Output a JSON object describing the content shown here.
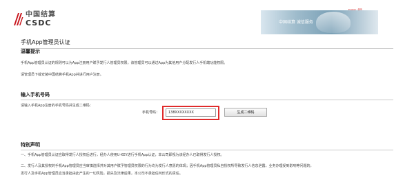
{
  "header": {
    "logo_cn": "中国结算",
    "logo_en": "CSDC",
    "top_link": "English | 首页",
    "banner_text": "中国结算 诚信服务"
  },
  "page": {
    "title": "手机App管理员认证"
  },
  "notice": {
    "heading": "温馨提示",
    "line1": "手机App管理员认证的规则可以为App注册用户赋予发行人管理员权限，该管理员可以通过App为其他用户分配发行人手机端功能权限。",
    "line2": "请管理员下载安装中国结算手机App并进行用户注册。"
  },
  "phone_section": {
    "heading": "输入手机号码",
    "instruction": "请输入手机App注册的手机号码并生成二维码：",
    "phone_label": "手机号码：",
    "phone_value": "138XXXXXXXX",
    "generate_button": "生成二维码"
  },
  "disclaimer": {
    "heading": "特别声明",
    "line1": "一、手机App管理员认证应取得发行人授权后进行，经办人使用U-KEY进行手机App认证，本公司即视为该经办人已取得发行人授权。",
    "line2": "二、发行人及其授权的手机App管理员应当审慎选择并对其用户赋予管理员权限的行为均为发行人意愿的体现；因手机App管理员私自授权所导致发行人信息泄露，业务办理受到影响等问题的，",
    "line3": "发行人及手机App管理员应当承担由此产生的一切风险，损失及法律后果，本公司不承担任何形式的责任。"
  }
}
